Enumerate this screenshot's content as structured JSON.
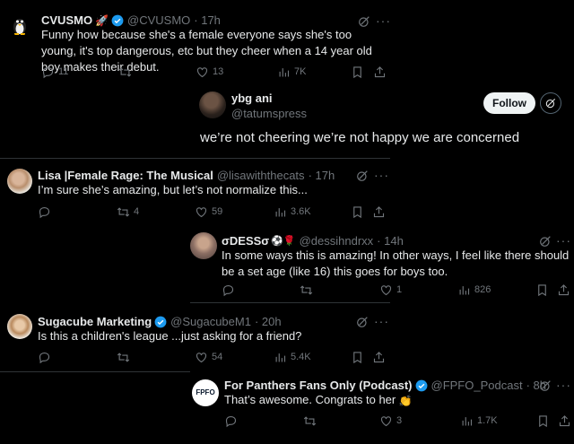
{
  "tweets": {
    "t1": {
      "name": "CVUSMO",
      "handle": "@CVUSMO",
      "time": "· 17h",
      "text": "Funny how because she's a female everyone says she's too young, it's top dangerous, etc but they cheer when a 14 year old boy makes their debut.",
      "replies": "11",
      "retweets": "",
      "likes": "13",
      "views": "7K"
    },
    "main": {
      "name": "ybg ani",
      "handle": "@tatumspress",
      "follow_label": "Follow",
      "text": "we’re not cheering we’re not happy we are concerned"
    },
    "t2": {
      "name": "Lisa |Female Rage: The Musical",
      "handle": "@lisawiththecats",
      "time": "· 17h",
      "text": "I’m sure she’s amazing, but let’s not normalize this...",
      "replies": "",
      "retweets": "4",
      "likes": "59",
      "views": "3.6K"
    },
    "t3": {
      "name": "σDESSσ",
      "handle": "@dessihndrxx",
      "time": "· 14h",
      "text": "In some ways this is amazing! In other ways, I feel like there should be a set age (like 16) this goes for boys too.",
      "replies": "",
      "retweets": "",
      "likes": "1",
      "views": "826"
    },
    "t4": {
      "name": "Sugacube Marketing",
      "handle": "@SugacubeM1",
      "time": "· 20h",
      "text": "Is this a children's league ...just asking for a friend?",
      "replies": "",
      "retweets": "",
      "likes": "54",
      "views": "5.4K"
    },
    "t5": {
      "name": "For Panthers Fans Only (Podcast)",
      "handle": "@FPFO_Podcast",
      "time": "· 8h",
      "text": "That’s awesome. Congrats to her",
      "avatar_text": "FPFO",
      "replies": "",
      "retweets": "",
      "likes": "3",
      "views": "1.7K"
    }
  },
  "colors": {
    "background": "#000000",
    "text": "#e7e9ea",
    "muted": "#71767b",
    "verified": "#1d9bf0",
    "divider": "#2f3336"
  },
  "icons": [
    "reply-icon",
    "retweet-icon",
    "like-icon",
    "views-icon",
    "bookmark-icon",
    "share-icon",
    "grok-icon",
    "more-icon",
    "verified-badge-icon"
  ]
}
